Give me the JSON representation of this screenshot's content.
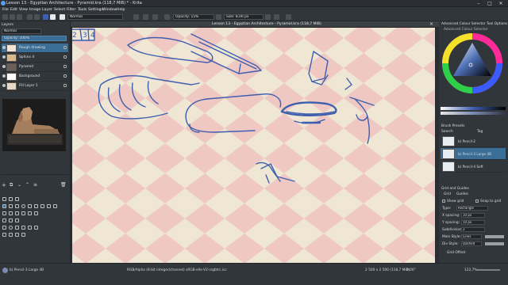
{
  "window": {
    "title": "Lesson 13 - Egyptian Architecture - Pyramid.kra (118,7 MiB) * - Krita",
    "minimize": "–",
    "maximize": "□",
    "close": "✕"
  },
  "menu": [
    "File",
    "Edit",
    "View",
    "Image",
    "Layer",
    "Select",
    "Filter",
    "Tools",
    "Settings",
    "Window",
    "Help"
  ],
  "toolbar": {
    "blend_mode": "Normal",
    "opacity": "Opacity: 15%",
    "size": "Size: 8,00 px"
  },
  "layers_panel": {
    "title": "Layers",
    "mode": "Normal",
    "opacity": "Opacity: 100%",
    "layers": [
      {
        "name": "Rough drawing"
      },
      {
        "name": "Sphinx 4"
      },
      {
        "name": "Pyramid"
      },
      {
        "name": "Background"
      },
      {
        "name": "Fill Layer 1"
      }
    ]
  },
  "document": {
    "tab_title": "Lesson 13 - Egyptian Architecture - Pyramid.kra (118,7 MiB)",
    "tab_numbers": [
      "2",
      "3",
      "4"
    ]
  },
  "colors": {
    "canvas_beige": "#efe6d4",
    "canvas_pink": "#efc8c4",
    "stroke_blue": "#3e5fae",
    "selected_preset": "#3a6e96"
  },
  "color_panel": {
    "title": "Advanced Colour Selector",
    "tab_title": "Advanced Colour Selector",
    "tool_options_tab": "Tool Options"
  },
  "brush_presets": {
    "title": "Brush Presets",
    "search_label": "Search",
    "tag_label": "Tag",
    "presets": [
      {
        "name": "b) Pencil-2"
      },
      {
        "name": "b) Pencil-3 Large 4B"
      },
      {
        "name": "b) Pencil-4 Soft"
      }
    ]
  },
  "grid_panel": {
    "title": "Grid and Guides",
    "tabs": [
      "Grid",
      "Guides"
    ],
    "show_grid": "Show grid",
    "snap_to_grid": "Snap to grid",
    "type_label": "Type:",
    "type_value": "Rectangle",
    "x_spacing_label": "X spacing:",
    "x_spacing": "10 px",
    "y_spacing_label": "Y spacing:",
    "y_spacing": "10 px",
    "subdivision_label": "Subdivision:",
    "subdivision": "2",
    "main_style_label": "Main Style:",
    "main_style": "Lines",
    "div_style_label": "Div Style:",
    "div_style": "Dashed",
    "grid_offset": "Grid Offset"
  },
  "status": {
    "brush_name": "b) Pencil-3 Large 4B",
    "color_space": "RGB/Alpha (8-bit integer/channel) sRGB-elle-V2-srgbtrc.icc",
    "dimensions": "2 500 x 2 500 (118,7 MiB)",
    "rotation": "0,00°",
    "zoom": "122,7%"
  }
}
